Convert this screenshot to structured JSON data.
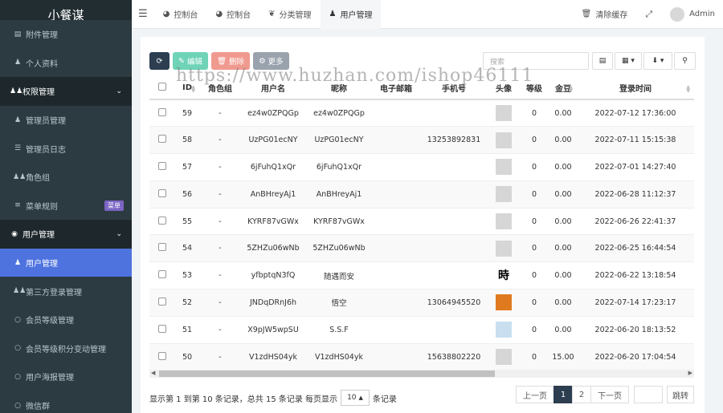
{
  "app": {
    "name": "小餐谋"
  },
  "sidebar": {
    "items": [
      {
        "label": "附件管理",
        "icon": "file-icon",
        "type": "sub"
      },
      {
        "label": "个人资料",
        "icon": "user-icon",
        "type": "sub"
      },
      {
        "label": "权限管理",
        "icon": "users-icon",
        "type": "header",
        "chevron": "⌄"
      },
      {
        "label": "管理员管理",
        "icon": "user-icon",
        "type": "sub"
      },
      {
        "label": "管理员日志",
        "icon": "list-icon",
        "type": "sub"
      },
      {
        "label": "角色组",
        "icon": "group-icon",
        "type": "sub"
      },
      {
        "label": "菜单规则",
        "icon": "menu-icon",
        "type": "sub",
        "badge": "菜单"
      },
      {
        "label": "用户管理",
        "icon": "user-circle-icon",
        "type": "header",
        "chevron": "⌄"
      },
      {
        "label": "用户管理",
        "icon": "user-icon",
        "type": "active"
      },
      {
        "label": "第三方登录管理",
        "icon": "group-icon",
        "type": "sub"
      },
      {
        "label": "会员等级管理",
        "icon": "circle-icon",
        "type": "sub"
      },
      {
        "label": "会员等级积分变动管理",
        "icon": "circle-icon",
        "type": "sub"
      },
      {
        "label": "用户海报管理",
        "icon": "circle-icon",
        "type": "sub"
      },
      {
        "label": "微信群",
        "icon": "circle-icon",
        "type": "sub"
      }
    ]
  },
  "topbar": {
    "tabs": [
      {
        "label": "控制台",
        "icon": "dashboard-icon"
      },
      {
        "label": "控制台",
        "icon": "dashboard-icon"
      },
      {
        "label": "分类管理",
        "icon": "leaf-icon"
      },
      {
        "label": "用户管理",
        "icon": "user-icon"
      }
    ],
    "clear_cache": "清除缓存",
    "user": "Admin"
  },
  "toolbar": {
    "refresh_icon": "⟳",
    "edit": "编辑",
    "delete": "删除",
    "more": "更多",
    "search_placeholder": "搜索"
  },
  "watermark": "https://www.huzhan.com/ishop46111",
  "table": {
    "columns": [
      "ID",
      "角色组",
      "用户名",
      "昵称",
      "电子邮箱",
      "手机号",
      "头像",
      "等级",
      "金豆",
      "登录时间"
    ],
    "rows": [
      {
        "id": "59",
        "role": "-",
        "username": "ez4w0ZPQGp",
        "nickname": "ez4w0ZPQGp",
        "email": "",
        "phone": "",
        "avatar": "default",
        "level": "0",
        "beans": "0.00",
        "login": "2022-07-12 17:36:00"
      },
      {
        "id": "58",
        "role": "-",
        "username": "UzPG01ecNY",
        "nickname": "UzPG01ecNY",
        "email": "",
        "phone": "13253892831",
        "avatar": "default",
        "level": "0",
        "beans": "0.00",
        "login": "2022-07-11 15:15:38"
      },
      {
        "id": "57",
        "role": "-",
        "username": "6jFuhQ1xQr",
        "nickname": "6jFuhQ1xQr",
        "email": "",
        "phone": "",
        "avatar": "default",
        "level": "0",
        "beans": "0.00",
        "login": "2022-07-01 14:27:40"
      },
      {
        "id": "56",
        "role": "-",
        "username": "AnBHreyAj1",
        "nickname": "AnBHreyAj1",
        "email": "",
        "phone": "",
        "avatar": "default",
        "level": "0",
        "beans": "0.00",
        "login": "2022-06-28 11:12:37"
      },
      {
        "id": "55",
        "role": "-",
        "username": "KYRF87vGWx",
        "nickname": "KYRF87vGWx",
        "email": "",
        "phone": "",
        "avatar": "default",
        "level": "0",
        "beans": "0.00",
        "login": "2022-06-26 22:41:37"
      },
      {
        "id": "54",
        "role": "-",
        "username": "5ZHZu06wNb",
        "nickname": "5ZHZu06wNb",
        "email": "",
        "phone": "",
        "avatar": "default",
        "level": "0",
        "beans": "0.00",
        "login": "2022-06-25 16:44:54"
      },
      {
        "id": "53",
        "role": "-",
        "username": "yfbptqN3fQ",
        "nickname": "随遇而安",
        "email": "",
        "phone": "",
        "avatar": "char",
        "avatar_char": "時",
        "level": "0",
        "beans": "0.00",
        "login": "2022-06-22 13:18:54"
      },
      {
        "id": "52",
        "role": "-",
        "username": "JNDqDRnJ6h",
        "nickname": "悟空",
        "email": "",
        "phone": "13064945520",
        "avatar": "flower",
        "level": "0",
        "beans": "0.00",
        "login": "2022-07-14 17:23:17"
      },
      {
        "id": "51",
        "role": "-",
        "username": "X9pJW5wpSU",
        "nickname": "S.S.F",
        "email": "",
        "phone": "",
        "avatar": "pink",
        "level": "0",
        "beans": "0.00",
        "login": "2022-06-20 18:13:52"
      },
      {
        "id": "50",
        "role": "-",
        "username": "V1zdHS04yk",
        "nickname": "V1zdHS04yk",
        "email": "",
        "phone": "15638802220",
        "avatar": "default",
        "level": "0",
        "beans": "15.00",
        "login": "2022-06-20 17:04:54"
      }
    ]
  },
  "footer": {
    "summary_prefix": "显示第 1 到第 10 条记录，总共 15 条记录 每页显示",
    "page_size": "10",
    "summary_suffix": "条记录",
    "prev": "上一页",
    "pages": [
      "1",
      "2"
    ],
    "next": "下一页",
    "goto": "跳转"
  },
  "colors": {
    "sidebar_bg": "#222d32",
    "active": "#4e73df",
    "primary_dark": "#2c3e50",
    "edit": "#6fd3b8",
    "delete": "#f09a8f"
  }
}
